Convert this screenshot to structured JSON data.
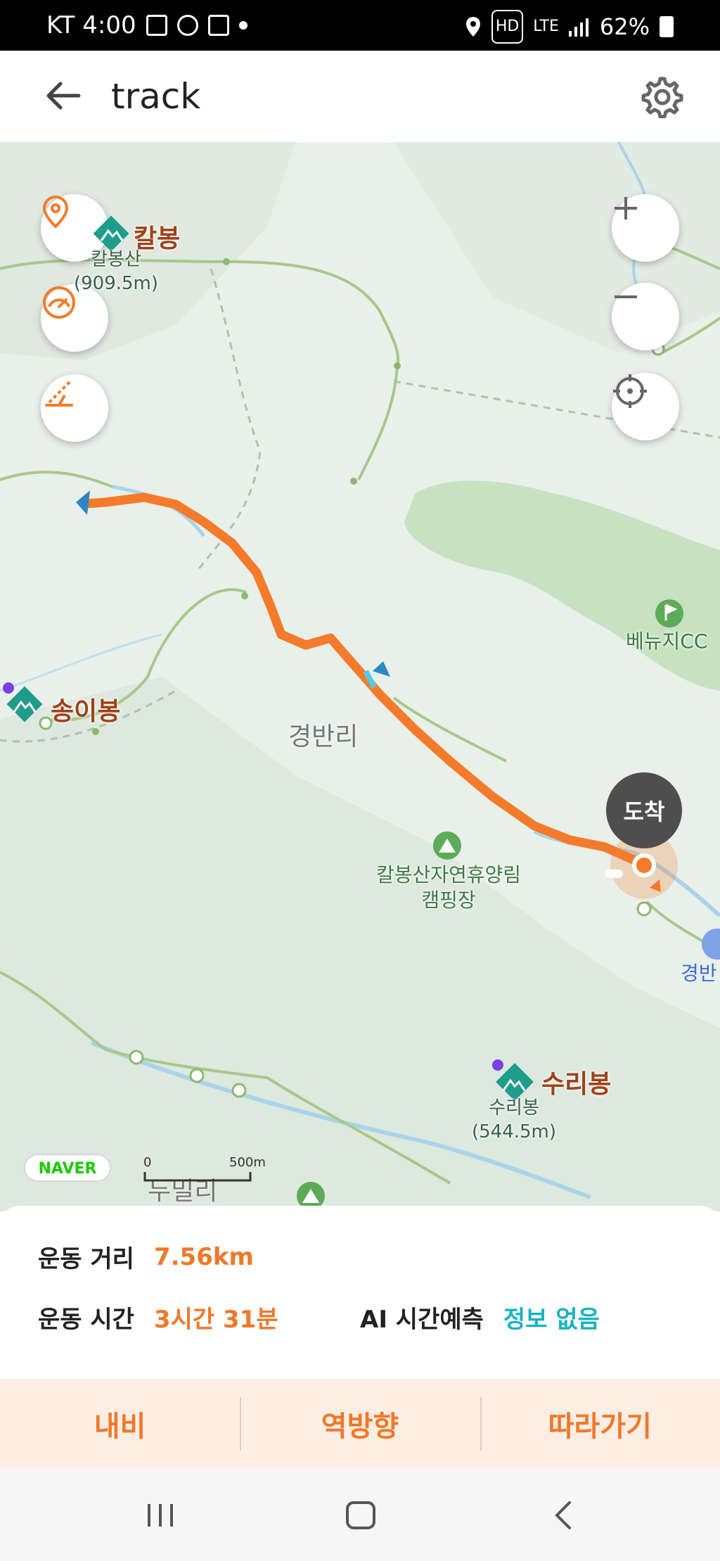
{
  "status_bar": {
    "carrier_time": "KT 4:00",
    "battery": "62%",
    "network": "LTE",
    "hd": "HD"
  },
  "header": {
    "title": "track"
  },
  "map": {
    "peaks": [
      {
        "name": "칼봉",
        "sub": "칼봉산\n(909.5m)"
      },
      {
        "name": "송이봉"
      },
      {
        "name": "수리봉",
        "sub": "수리봉\n(544.5m)"
      }
    ],
    "labels": {
      "village1": "경반리",
      "village2": "두밀리",
      "golf": "베뉴지CC",
      "camp": "칼봉산자연휴양림\n캠핑장",
      "edge_label": "경반"
    },
    "scale": {
      "start": "0",
      "end": "500m"
    },
    "brand": "NAVER",
    "arrive": "도착",
    "route_color": "#f47b2b"
  },
  "info": {
    "distance_label": "운동 거리",
    "distance_value": "7.56km",
    "time_label": "운동 시간",
    "time_value": "3시간 31분",
    "ai_label": "AI 시간예측",
    "ai_value": "정보 없음"
  },
  "actions": {
    "nav": "내비",
    "reverse": "역방향",
    "follow": "따라가기"
  }
}
